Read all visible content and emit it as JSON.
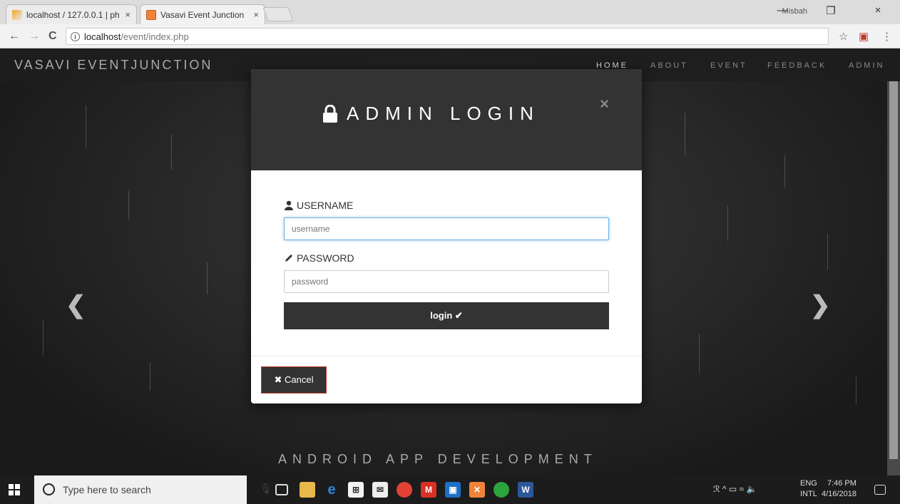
{
  "browser": {
    "tabs": [
      {
        "title": "localhost / 127.0.0.1 | ph",
        "close": "×"
      },
      {
        "title": "Vasavi Event Junction",
        "close": "×"
      }
    ],
    "profile": "Misbah",
    "window_controls": {
      "minimize": "—",
      "restore": "❐",
      "close": "×"
    },
    "nav": {
      "back": "←",
      "forward": "→",
      "reload": "C"
    },
    "address": {
      "host": "localhost",
      "path": "/event/index.php"
    },
    "bookmark_icon": "☆",
    "extension_icon": "▣",
    "menu_icon": "⋮"
  },
  "site": {
    "brand": "VASAVI EVENTJUNCTION",
    "menu": [
      "HOME",
      "ABOUT",
      "EVENT",
      "FEEDBACK",
      "ADMIN"
    ],
    "prev_arrow": "❮",
    "next_arrow": "❯",
    "caption": "ANDROID APP DEVELOPMENT"
  },
  "modal": {
    "title": "ADMIN LOGIN",
    "close": "×",
    "username_label": "USERNAME",
    "username_placeholder": "username",
    "password_label": "PASSWORD",
    "password_placeholder": "password",
    "login_label": "login ✔",
    "cancel_label": "✖ Cancel"
  },
  "taskbar": {
    "search_placeholder": "Type here to search",
    "lang_top": "ENG",
    "lang_bottom": "INTL",
    "time": "7:46 PM",
    "date": "4/16/2018",
    "tray_icons": "ℛ  ^  ▭  ≈  🔈"
  },
  "colors": {
    "modal_header": "#333333",
    "login_button": "#333333",
    "focus_border": "#66afe9",
    "cancel_border": "#c0392b"
  }
}
